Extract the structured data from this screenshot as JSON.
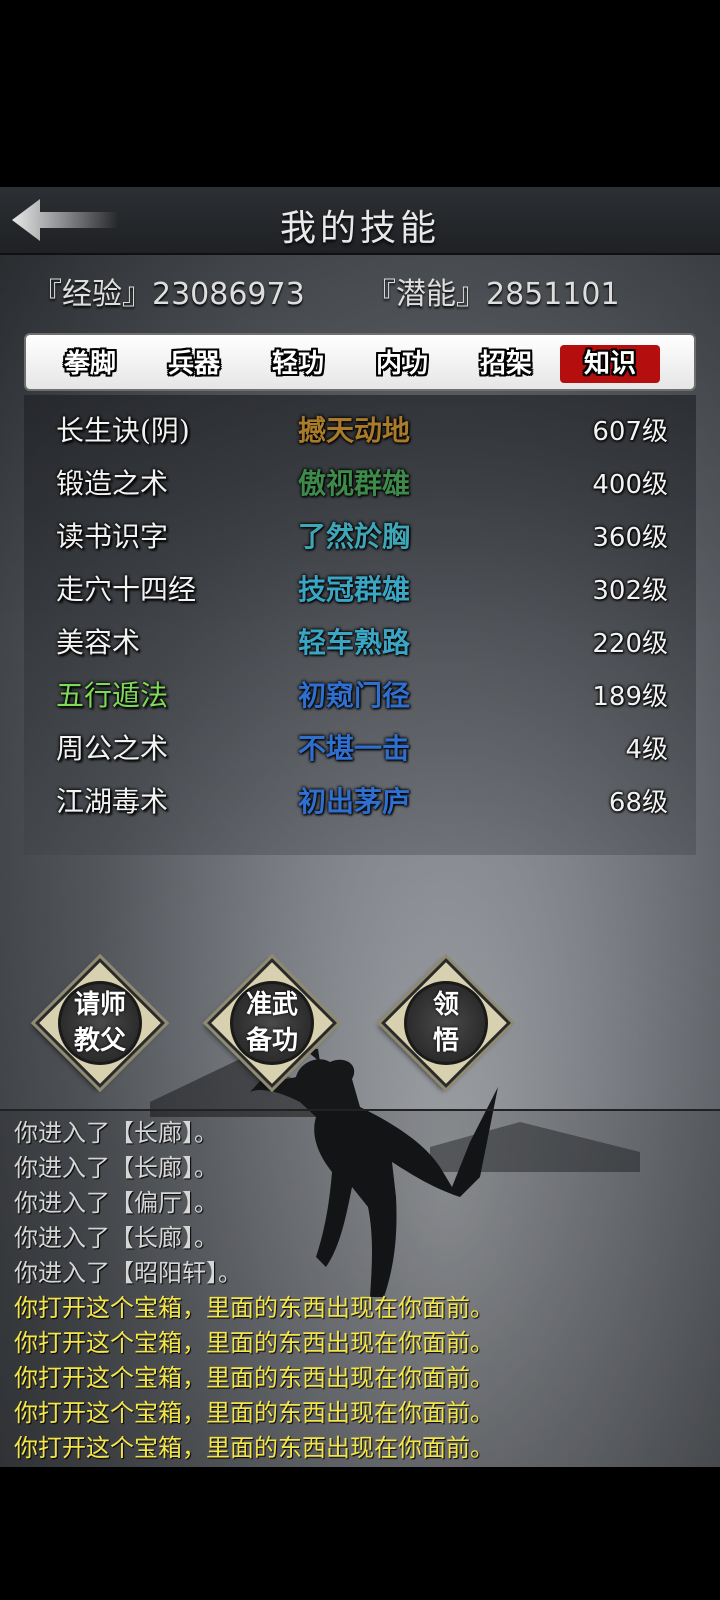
{
  "header": {
    "title": "我的技能"
  },
  "stats": {
    "exp": "『经验』23086973",
    "potential": "『潜能』2851101"
  },
  "tabs": [
    {
      "label": "拳脚",
      "active": false
    },
    {
      "label": "兵器",
      "active": false
    },
    {
      "label": "轻功",
      "active": false
    },
    {
      "label": "内功",
      "active": false
    },
    {
      "label": "招架",
      "active": false
    },
    {
      "label": "知识",
      "active": true
    }
  ],
  "skills": [
    {
      "name": "长生诀(阴)",
      "rank": "撼天动地",
      "level": "607级",
      "name_color": "#f2f2f2",
      "rank_color": "#a87a2a"
    },
    {
      "name": "锻造之术",
      "rank": "傲视群雄",
      "level": "400级",
      "name_color": "#f2f2f2",
      "rank_color": "#3e8a4a"
    },
    {
      "name": "读书识字",
      "rank": "了然於胸",
      "level": "360级",
      "name_color": "#f2f2f2",
      "rank_color": "#3fa6b8"
    },
    {
      "name": "走穴十四经",
      "rank": "技冠群雄",
      "level": "302级",
      "name_color": "#f2f2f2",
      "rank_color": "#3aa6c4"
    },
    {
      "name": "美容术",
      "rank": "轻车熟路",
      "level": "220级",
      "name_color": "#f2f2f2",
      "rank_color": "#3aa6c4"
    },
    {
      "name": "五行遁法",
      "rank": "初窥门径",
      "level": "189级",
      "name_color": "#7ed957",
      "rank_color": "#2f6fd0"
    },
    {
      "name": "周公之术",
      "rank": "不堪一击",
      "level": "4级",
      "name_color": "#f2f2f2",
      "rank_color": "#2f6fd0"
    },
    {
      "name": "江湖毒术",
      "rank": "初出茅庐",
      "level": "68级",
      "name_color": "#f2f2f2",
      "rank_color": "#2f6fd0"
    }
  ],
  "actions": [
    {
      "label": "请师\n教父"
    },
    {
      "label": "准武\n备功"
    },
    {
      "label": "领\n悟"
    }
  ],
  "log": [
    {
      "text": "你进入了【长廊】。",
      "type": "sys"
    },
    {
      "text": "你进入了【长廊】。",
      "type": "sys"
    },
    {
      "text": "你进入了【偏厅】。",
      "type": "sys"
    },
    {
      "text": "你进入了【长廊】。",
      "type": "sys"
    },
    {
      "text": "你进入了【昭阳轩】。",
      "type": "sys"
    },
    {
      "text": "你打开这个宝箱，里面的东西出现在你面前。",
      "type": "gold"
    },
    {
      "text": "你打开这个宝箱，里面的东西出现在你面前。",
      "type": "gold"
    },
    {
      "text": "你打开这个宝箱，里面的东西出现在你面前。",
      "type": "gold"
    },
    {
      "text": "你打开这个宝箱，里面的东西出现在你面前。",
      "type": "gold"
    },
    {
      "text": "你打开这个宝箱，里面的东西出现在你面前。",
      "type": "gold"
    }
  ],
  "colors": {
    "active_tab": "#b40e0e",
    "log_gold": "#f4e54a"
  },
  "icons": {
    "back": "back-arrow-icon"
  }
}
